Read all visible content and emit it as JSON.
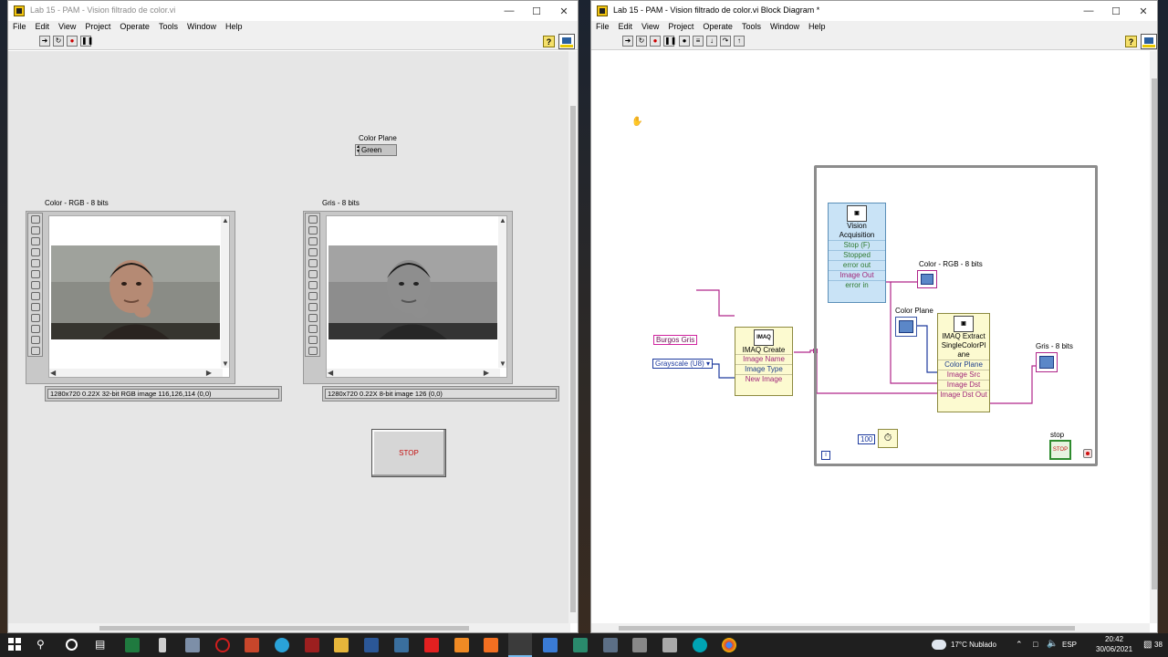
{
  "front_panel": {
    "title": "Lab 15 - PAM - Vision filtrado de color.vi",
    "menu": [
      "File",
      "Edit",
      "View",
      "Project",
      "Operate",
      "Tools",
      "Window",
      "Help"
    ],
    "color_plane": {
      "label": "Color Plane",
      "value": "Green"
    },
    "display_rgb": {
      "label": "Color - RGB - 8 bits",
      "status": "1280x720 0.22X 32-bit RGB image 116,126,114     (0,0)"
    },
    "display_gray": {
      "label": "Gris - 8 bits",
      "status": "1280x720 0.22X 8-bit image 126     (0,0)"
    },
    "stop_button": "STOP"
  },
  "block_diagram": {
    "title": "Lab 15 - PAM - Vision filtrado de color.vi Block Diagram *",
    "menu": [
      "File",
      "Edit",
      "View",
      "Project",
      "Operate",
      "Tools",
      "Window",
      "Help"
    ],
    "vision_acquisition": {
      "name": "Vision Acquisition",
      "terminals": [
        "Stop (F)",
        "Stopped",
        "error out",
        "Image Out",
        "error in"
      ]
    },
    "imaq_create": {
      "name": "IMAQ Create",
      "terminals": [
        "Image Name",
        "Image Type",
        "New Image"
      ]
    },
    "imaq_extract": {
      "name": "IMAQ ExtractSingleColorPlane",
      "terminals": [
        "Color Plane",
        "Image Src",
        "Image Dst",
        "Image Dst Out"
      ]
    },
    "string_const": "Burgos Gris",
    "enum_const": "Grayscale (U8)",
    "rgb_indicator_label": "Color - RGB - 8 bits",
    "color_plane_label": "Color Plane",
    "gray_indicator_label": "Gris - 8 bits",
    "wait_ms": "100",
    "stop_label": "stop",
    "loop_iteration": "i"
  },
  "taskbar": {
    "weather": "17°C Nublado",
    "language": "ESP",
    "time": "20:42",
    "date": "30/06/2021",
    "notifications": "38"
  },
  "colors": {
    "accent_pink": "#d0239f",
    "loop_border": "#8c8c8c",
    "stop_text": "#c41010"
  }
}
